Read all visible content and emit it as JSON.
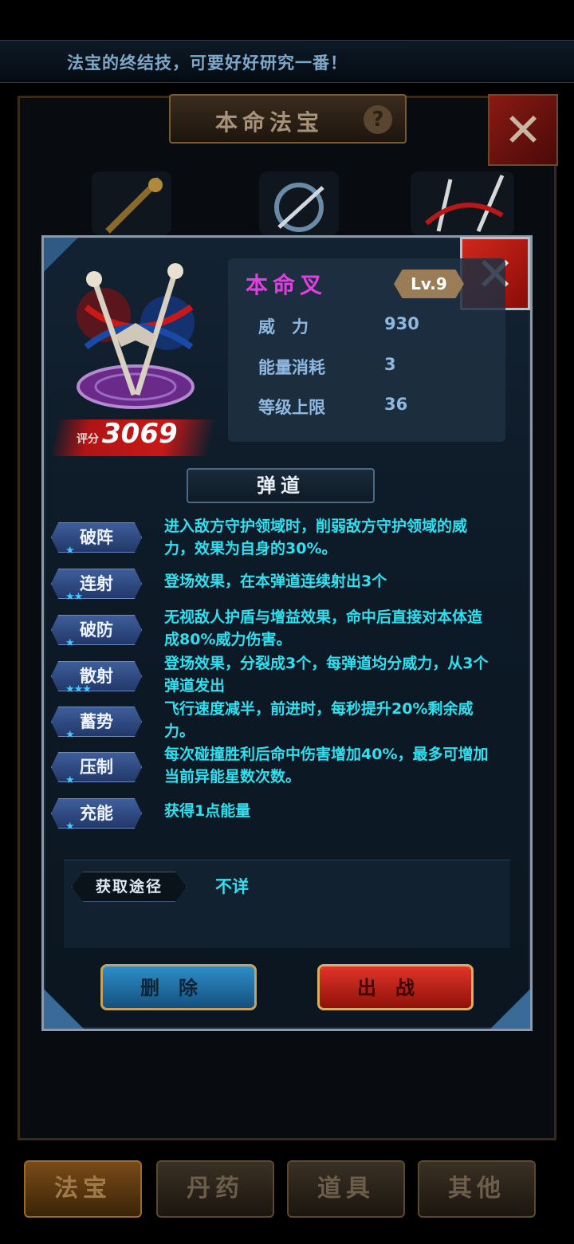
{
  "top_hint": "法宝的终结技，可要好好研究一番！",
  "bg_window": {
    "title": "本命法宝",
    "help_icon": "?",
    "close_icon": "✕"
  },
  "bottom_tabs": [
    "法宝",
    "丹药",
    "道具",
    "其他"
  ],
  "dialog": {
    "close_icon": "✕",
    "item": {
      "name": "本命叉",
      "level": "Lv.9",
      "score_label": "评分",
      "score": "3069"
    },
    "stats": [
      {
        "label": "威　力",
        "value": "930"
      },
      {
        "label": "能量消耗",
        "value": "3"
      },
      {
        "label": "等级上限",
        "value": "36"
      }
    ],
    "section_title": "弹道",
    "skills": [
      {
        "name": "破阵",
        "stars": "★",
        "desc": "进入敌方守护领域时，削弱敌方守护领域的威力，效果为自身的30%。"
      },
      {
        "name": "连射",
        "stars": "★★",
        "desc": "登场效果，在本弹道连续射出3个"
      },
      {
        "name": "破防",
        "stars": "★",
        "desc": "无视敌人护盾与增益效果，命中后直接对本体造成80%威力伤害。"
      },
      {
        "name": "散射",
        "stars": "★★★",
        "desc": "登场效果，分裂成3个，每弹道均分威力，从3个弹道发出"
      },
      {
        "name": "蓄势",
        "stars": "★",
        "desc": "飞行速度减半，前进时，每秒提升20%剩余威力。"
      },
      {
        "name": "压制",
        "stars": "★",
        "desc": "每次碰撞胜利后命中伤害增加40%，最多可增加当前异能星数次数。"
      },
      {
        "name": "充能",
        "stars": "★",
        "desc": "获得1点能量"
      }
    ],
    "source_label": "获取途径",
    "source_value": "不详",
    "buttons": {
      "delete": "删除",
      "deploy": "出战"
    }
  }
}
